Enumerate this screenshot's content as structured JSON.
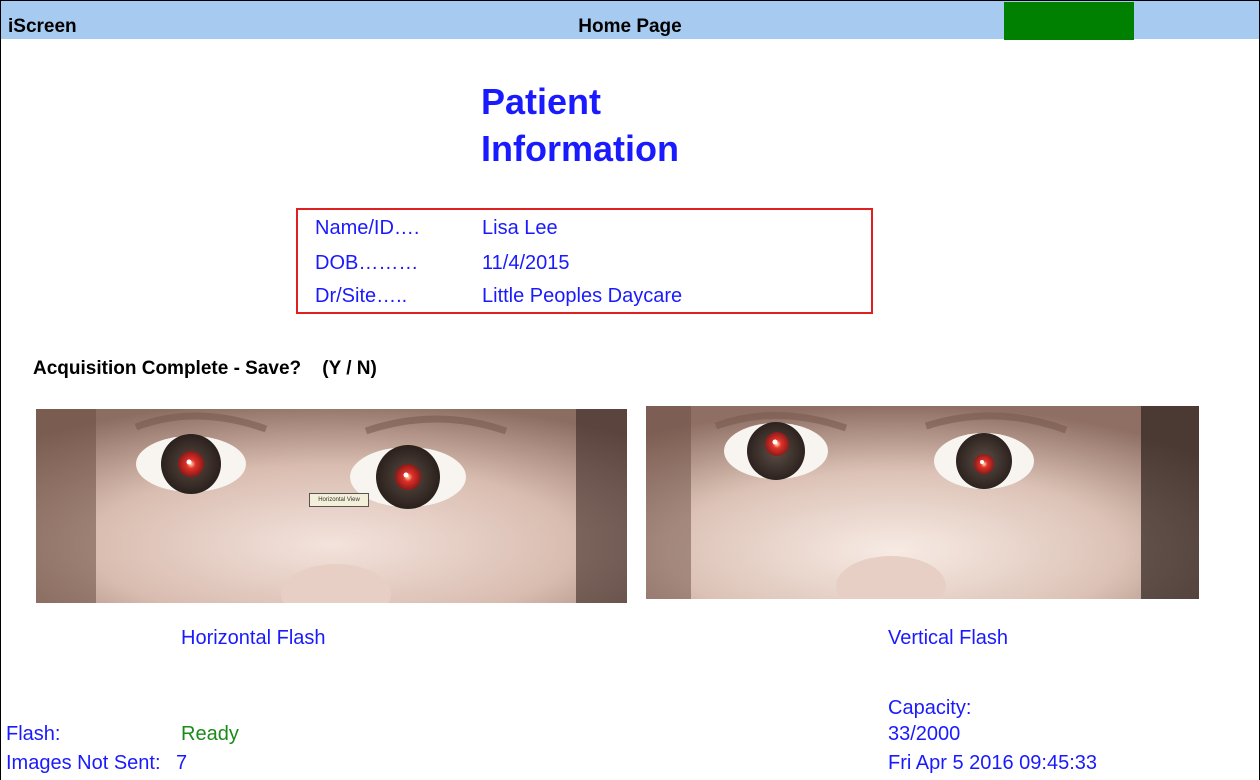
{
  "titlebar": {
    "app_name": "iScreen",
    "page_title": "Home Page",
    "status_color": "#008000"
  },
  "patient": {
    "heading_line1": "Patient",
    "heading_line2": "Information",
    "name_label": "Name/ID….",
    "name_value": "Lisa Lee",
    "dob_label": "DOB………",
    "dob_value": "11/4/2015",
    "site_label": "Dr/Site…..",
    "site_value": "Little Peoples Daycare"
  },
  "prompt": "Acquisition Complete - Save?    (Y / N)",
  "images": {
    "left_caption": "Horizontal Flash",
    "left_overlay": "Horizontal View",
    "right_caption": "Vertical Flash"
  },
  "footer": {
    "flash_label": "Flash:",
    "flash_status": "Ready",
    "images_not_sent_label": "Images Not Sent:",
    "images_not_sent_value": "7",
    "capacity_label": "Capacity:",
    "capacity_value": "33/2000",
    "datetime": "Fri Apr 5 2016 09:45:33"
  },
  "colors": {
    "title_bar": "#a6caf0",
    "accent_text": "#1a1aff",
    "box_border": "#e02020",
    "ready": "#1a8a1a"
  }
}
